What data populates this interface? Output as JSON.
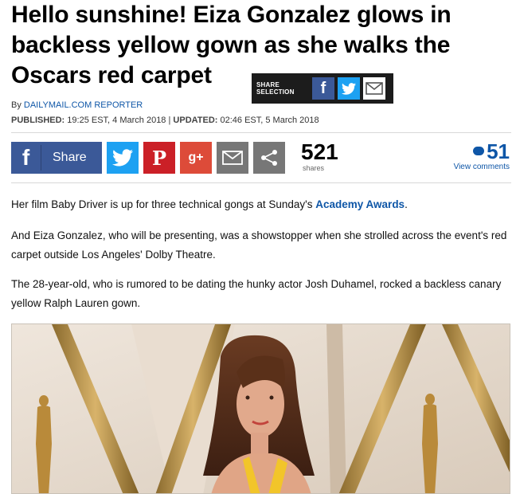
{
  "article": {
    "headline": "Hello sunshine! Eiza Gonzalez glows in backless yellow gown as she walks the Oscars red carpet",
    "share_selection_label": "SHARE SELECTION",
    "byline_prefix": "By",
    "byline_reporter": "DAILYMAIL.COM REPORTER",
    "published_label": "PUBLISHED:",
    "published_value": "19:25 EST, 4 March 2018",
    "updated_label": "UPDATED:",
    "updated_value": "02:46 EST, 5 March 2018",
    "separator": "|"
  },
  "share_bar": {
    "facebook_label": "Share",
    "share_count": "521",
    "share_count_label": "shares",
    "comment_count": "51",
    "comment_label": "View comments"
  },
  "paragraphs": {
    "p1_text": "Her film Baby Driver is up for three technical gongs at Sunday's ",
    "p1_link": "Academy Awards",
    "p1_end": ".",
    "p2": "And Eiza Gonzalez, who will be presenting, was a showstopper when she strolled across the event's red carpet outside Los Angeles' Dolby Theatre.",
    "p3": "The 28-year-old, who is rumored to be dating the hunky actor Josh Duhamel, rocked a backless canary yellow Ralph Lauren gown."
  },
  "colors": {
    "facebook": "#3b5998",
    "twitter": "#1da1f2",
    "pinterest": "#cb2027",
    "google_plus": "#dd4b39",
    "link_blue": "#0e56a7"
  },
  "icons": [
    "facebook-icon",
    "twitter-icon",
    "pinterest-icon",
    "google-plus-icon",
    "email-icon",
    "share-icon",
    "comment-bubble-icon"
  ]
}
